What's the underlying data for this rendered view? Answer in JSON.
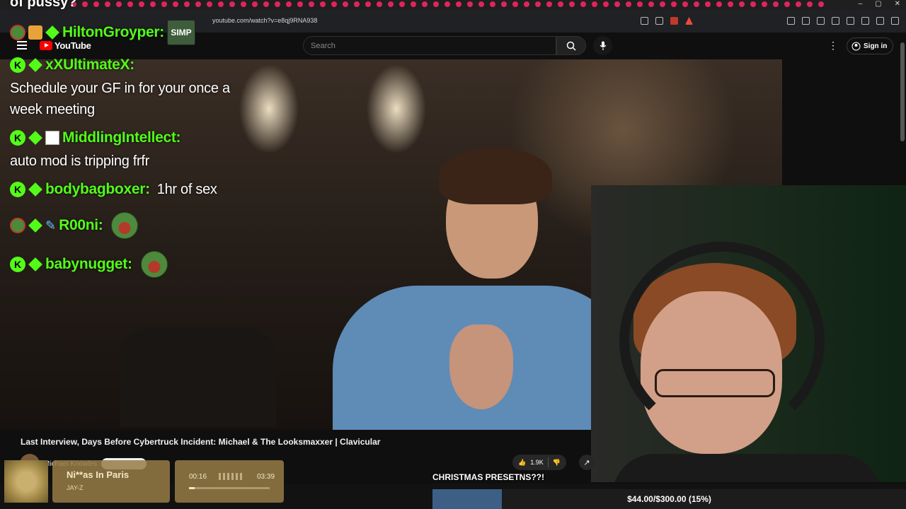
{
  "browser": {
    "url": "youtube.com/watch?v=e8qj9RNA938",
    "window_controls": [
      "–",
      "▢",
      "✕"
    ]
  },
  "youtube": {
    "logo_text": "YouTube",
    "search_placeholder": "Search",
    "sign_in_label": "Sign in"
  },
  "chat": {
    "cutoff_text": "of pussy?",
    "messages": [
      {
        "user": "HiltonGroyper:",
        "emote": "SIMP"
      },
      {
        "user": "xXUltimateX:",
        "text": "Schedule your GF in for your once a week meeting"
      },
      {
        "user": "MiddlingIntellect:",
        "text": "auto mod is tripping frfr"
      },
      {
        "user": "bodybagboxer:",
        "text": "1hr of sex"
      },
      {
        "user": "R00ni:"
      },
      {
        "user": "babynugget:"
      }
    ]
  },
  "video": {
    "title": "Last Interview, Days Before Cybertruck Incident: Michael & The Looksmaxxer | Clavicular",
    "channel_name": "Michael Knowles",
    "like_count": "1.9K"
  },
  "music": {
    "title": "Ni**as In Paris",
    "artist": "JAY-Z",
    "elapsed": "00:16",
    "total": "03:39",
    "progress_fraction": 0.073
  },
  "goal": {
    "label": "CHRISTMAS PRESETNS??!",
    "text": "$44.00/$300.00 (15%)",
    "fraction": 0.1467
  },
  "colors": {
    "kick_green": "#53fc18",
    "goal_fill": "#3d5f86",
    "yt_red": "#ff0000"
  }
}
